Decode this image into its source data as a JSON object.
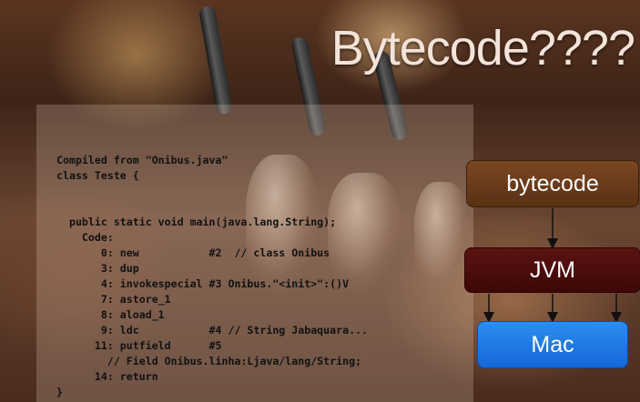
{
  "slide": {
    "title": "Bytecode????",
    "code_lines": [
      "Compiled from \"Onibus.java\"",
      "class Teste {",
      "",
      "",
      "  public static void main(java.lang.String);",
      "    Code:",
      "       0: new           #2  // class Onibus",
      "       3: dup",
      "       4: invokespecial #3 Onibus.\"<init>\":()V",
      "       7: astore_1",
      "       8: aload_1",
      "       9: ldc           #4 // String Jabaquara...",
      "      11: putfield      #5",
      "        // Field Onibus.linha:Ljava/lang/String;",
      "      14: return",
      "}"
    ],
    "diagram": {
      "bytecode_label": "bytecode",
      "jvm_label": "JVM",
      "mac_label": "Mac",
      "colors": {
        "bytecode": "#6a3a1a",
        "jvm": "#4a0c0c",
        "mac": "#1f7ae6"
      }
    }
  }
}
